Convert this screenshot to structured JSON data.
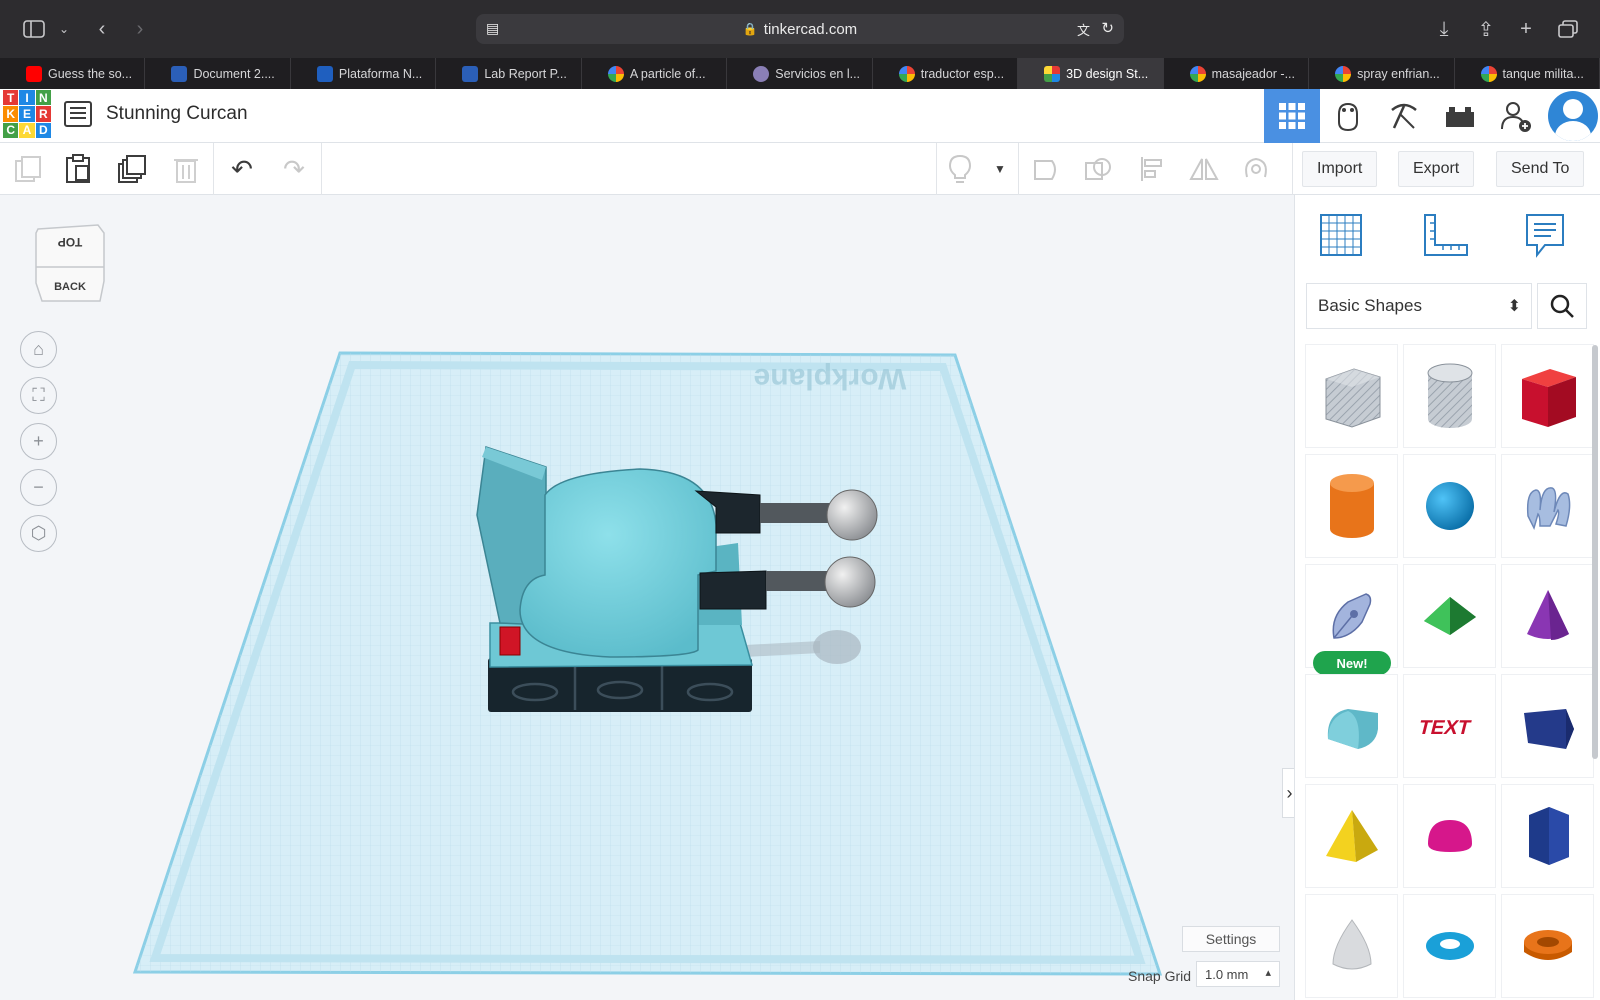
{
  "browser": {
    "url": "tinkercad.com",
    "tabs": [
      {
        "label": "Guess the so...",
        "favicon": "youtube-icon",
        "color": "#ff0000"
      },
      {
        "label": "Document 2....",
        "favicon": "word-icon",
        "color": "#2b5fb8"
      },
      {
        "label": "Plataforma N...",
        "favicon": "n-icon",
        "color": "#1f5fbf"
      },
      {
        "label": "Lab Report P...",
        "favicon": "word-icon",
        "color": "#2b5fb8"
      },
      {
        "label": "A particle of...",
        "favicon": "google-icon",
        "color": "#ffffff"
      },
      {
        "label": "Servicios en l...",
        "favicon": "seal-icon",
        "color": "#8a7fb6"
      },
      {
        "label": "traductor esp...",
        "favicon": "google-icon",
        "color": "#ffffff"
      },
      {
        "label": "3D design St...",
        "favicon": "tinkercad-icon",
        "color": "#ffffff",
        "active": true
      },
      {
        "label": "masajeador -...",
        "favicon": "google-icon",
        "color": "#ffffff"
      },
      {
        "label": "spray enfrian...",
        "favicon": "google-icon",
        "color": "#ffffff"
      },
      {
        "label": "tanque milita...",
        "favicon": "google-icon",
        "color": "#ffffff"
      }
    ]
  },
  "header": {
    "logo_letters": [
      "T",
      "I",
      "N",
      "K",
      "E",
      "R",
      "C",
      "A",
      "D"
    ],
    "project_name": "Stunning Curcan",
    "nav": [
      "grid-view-icon",
      "tinker-hand-icon",
      "pickaxe-icon",
      "bricks-icon",
      "add-user-icon"
    ]
  },
  "toolbar": {
    "import_label": "Import",
    "export_label": "Export",
    "send_to_label": "Send To"
  },
  "canvas": {
    "viewcube_top": "TOP",
    "viewcube_back": "BACK",
    "workplane_label": "Workplane",
    "settings_label": "Settings",
    "snap_grid_label": "Snap Grid",
    "snap_grid_value": "1.0 mm"
  },
  "panel": {
    "category": "Basic Shapes",
    "new_badge": "New!",
    "shapes": [
      "box-hole",
      "cylinder-hole",
      "box",
      "cylinder",
      "sphere",
      "scribble",
      "pen-tool",
      "roof",
      "cone",
      "round-roof",
      "text",
      "wedge",
      "pyramid",
      "half-sphere",
      "polygon",
      "paraboloid",
      "torus",
      "tube"
    ]
  }
}
